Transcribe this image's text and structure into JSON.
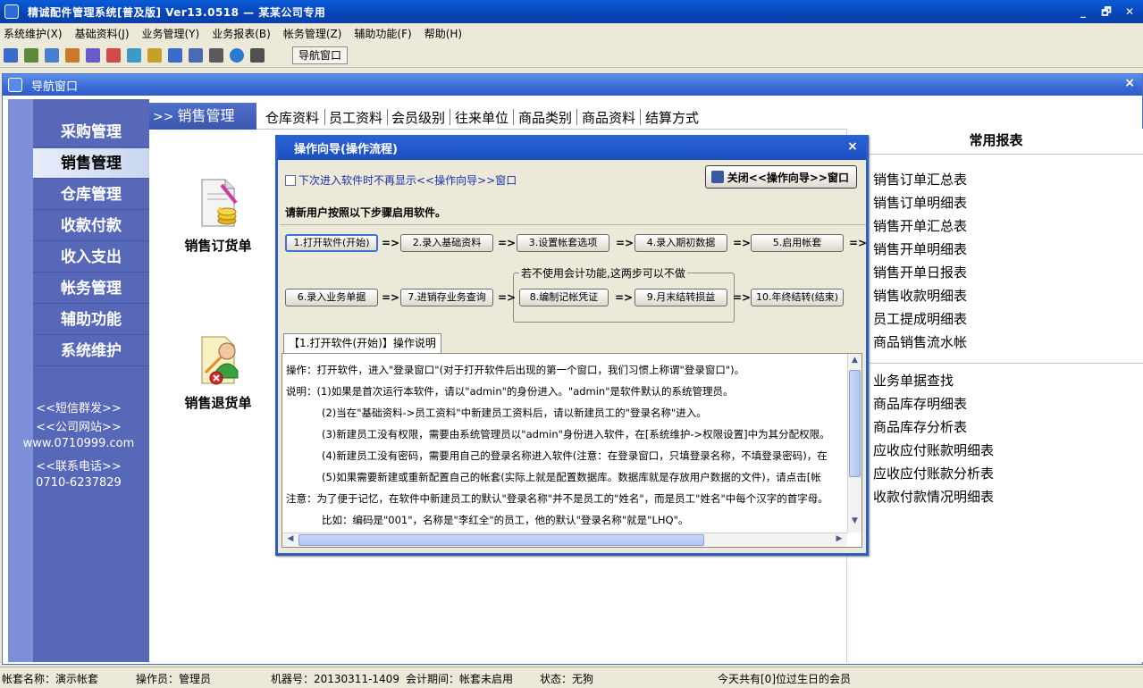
{
  "window": {
    "title": "精诚配件管理系统[普及版] Ver13.0518 — 某某公司专用",
    "controls": [
      "_",
      "🗗",
      "✕"
    ]
  },
  "menu": [
    "系统维护(X)",
    "基础资料(J)",
    "业务管理(Y)",
    "业务报表(B)",
    "帐务管理(Z)",
    "辅助功能(F)",
    "帮助(H)"
  ],
  "toolbar": {
    "nav_button": "导航窗口",
    "icon_colors": [
      "#3b6bc8",
      "#5a8a3a",
      "#4a7fd0",
      "#c87a28",
      "#6a5ac8",
      "#d04a4a",
      "#3a9ac8",
      "#c8a028",
      "#3b6bc8",
      "#4a6ab8",
      "#5a5a5a",
      "#2a7ad0",
      "#505050"
    ]
  },
  "nav_window": {
    "title": "导航窗口",
    "close": "×",
    "sidebar": {
      "items": [
        "采购管理",
        "销售管理",
        "仓库管理",
        "收款付款",
        "收入支出",
        "帐务管理",
        "辅助功能",
        "系统维护"
      ],
      "active_index": 1,
      "contact": [
        "<<短信群发>>",
        "<<公司网站>>",
        "www.0710999.com",
        "<<联系电话>>",
        "0710-6237829"
      ]
    },
    "tabs": {
      "current_prefix": ">>",
      "current": "销售管理",
      "links": [
        "仓库资料",
        "员工资料",
        "会员级别",
        "往来单位",
        "商品类别",
        "商品资料",
        "结算方式"
      ]
    },
    "docs": [
      "销售订货单",
      "销售退货单"
    ],
    "reports": {
      "title": "常用报表",
      "group1": [
        "销售订单汇总表",
        "销售订单明细表",
        "销售开单汇总表",
        "销售开单明细表",
        "销售开单日报表",
        "销售收款明细表",
        "员工提成明细表",
        "商品销售流水帐"
      ],
      "group2": [
        "业务单据查找",
        "商品库存明细表",
        "商品库存分析表",
        "应收应付账款明细表",
        "应收应付账款分析表",
        "收款付款情况明细表"
      ]
    }
  },
  "dialog": {
    "title": "操作向导(操作流程)",
    "close": "×",
    "checkbox_label": "下次进入软件时不再显示<<操作向导>>窗口",
    "close_button": "关闭<<操作向导>>窗口",
    "intro": "请新用户按照以下步骤启用软件。",
    "arrow": "=>",
    "steps_row1": [
      "1.打开软件(开始)",
      "2.录入基础资料",
      "3.设置帐套选项",
      "4.录入期初数据",
      "5.启用帐套"
    ],
    "steps_row2": [
      "6.录入业务单据",
      "7.进销存业务查询",
      "8.编制记帐凭证",
      "9.月末结转损益",
      "10.年终结转(结束)"
    ],
    "optional_label": "若不使用会计功能,这两步可以不做",
    "desc_tab": "【1.打开软件(开始)】操作说明",
    "desc_lines": [
      "操作：打开软件，进入\"登录窗口\"(对于打开软件后出现的第一个窗口，我们习惯上称谓\"登录窗口\")。",
      "说明：(1)如果是首次运行本软件，请以\"admin\"的身份进入。\"admin\"是软件默认的系统管理员。",
      "(2)当在\"基础资料->员工资料\"中新建员工资料后，请以新建员工的\"登录名称\"进入。",
      "(3)新建员工没有权限，需要由系统管理员以\"admin\"身份进入软件，在[系统维护->权限设置]中为其分配权限。",
      "(4)新建员工没有密码，需要用自己的登录名称进入软件(注意：在登录窗口，只填登录名称，不填登录密码)，在",
      "(5)如果需要新建或重新配置自己的帐套(实际上就是配置数据库。数据库就是存放用户数据的文件)，请点击[帐",
      "注意：为了便于记忆，在软件中新建员工的默认\"登录名称\"并不是员工的\"姓名\"，而是员工\"姓名\"中每个汉字的首字母。",
      "比如：编码是\"001\"，名称是\"李红全\"的员工，他的默认\"登录名称\"就是\"LHQ\"。"
    ]
  },
  "status": {
    "account": "帐套名称：演示帐套",
    "operator": "操作员：管理员",
    "machine": "机器号：20130311-1409",
    "period": "会计期间：帐套未启用",
    "state": "状态：无狗",
    "birthday": "今天共有[0]位过生日的会员"
  }
}
